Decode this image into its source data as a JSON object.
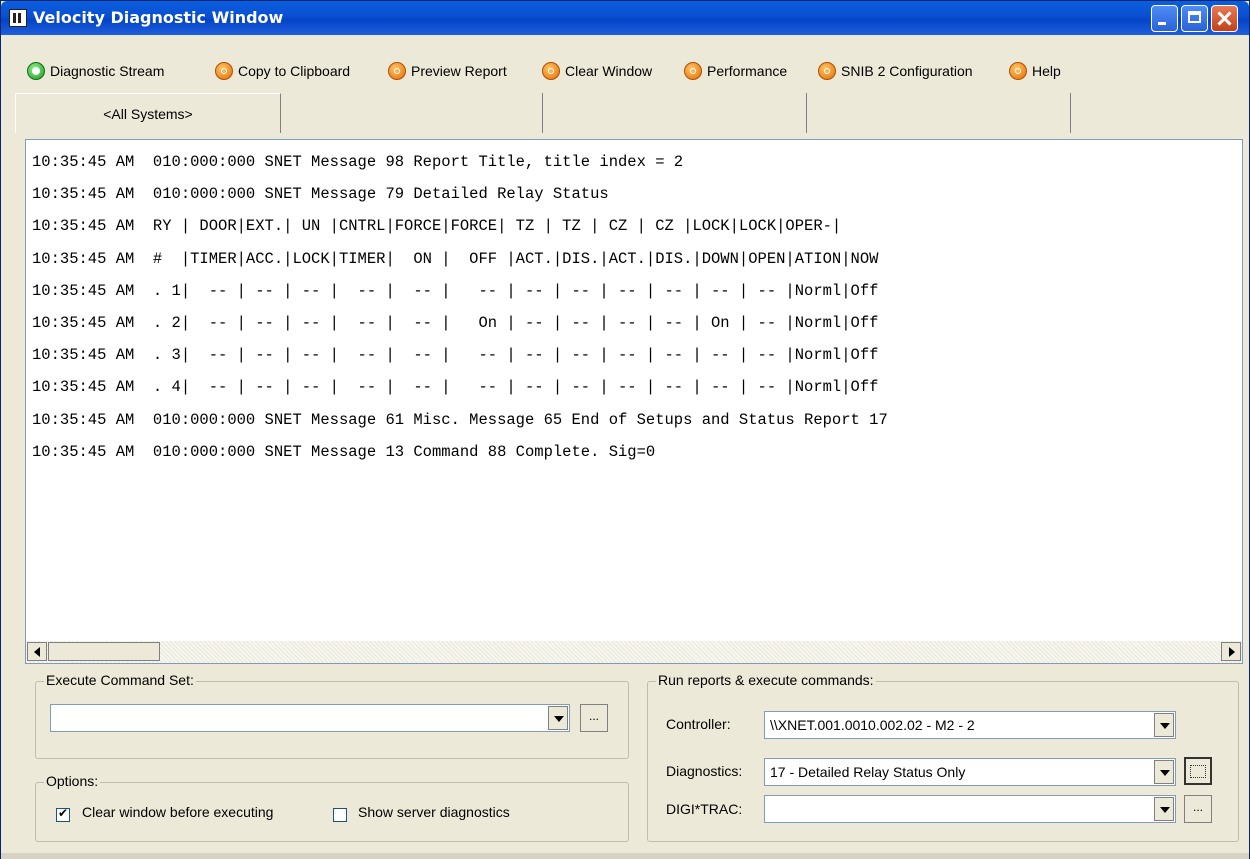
{
  "window": {
    "title": "Velocity Diagnostic Window"
  },
  "toolbar": {
    "items": [
      {
        "label": "Diagnostic Stream",
        "icon": "diagnostic-stream-icon"
      },
      {
        "label": "Copy to Clipboard",
        "icon": "copy-icon"
      },
      {
        "label": "Preview Report",
        "icon": "preview-icon"
      },
      {
        "label": "Clear Window",
        "icon": "clear-icon"
      },
      {
        "label": "Performance",
        "icon": "performance-icon"
      },
      {
        "label": "SNIB 2 Configuration",
        "icon": "snib-config-icon"
      },
      {
        "label": "Help",
        "icon": "help-icon"
      }
    ]
  },
  "tabs": [
    "<All Systems>",
    "",
    "",
    ""
  ],
  "log": {
    "lines": [
      "10:35:45 AM  010:000:000 SNET Message 98 Report Title, title index = 2",
      "10:35:45 AM  010:000:000 SNET Message 79 Detailed Relay Status",
      "10:35:45 AM  RY | DOOR|EXT.| UN |CNTRL|FORCE|FORCE| TZ | TZ | CZ | CZ |LOCK|LOCK|OPER-|",
      "10:35:45 AM  #  |TIMER|ACC.|LOCK|TIMER|  ON |  OFF |ACT.|DIS.|ACT.|DIS.|DOWN|OPEN|ATION|NOW",
      "10:35:45 AM  . 1|  -- | -- | -- |  -- |  -- |   -- | -- | -- | -- | -- | -- | -- |Norml|Off",
      "10:35:45 AM  . 2|  -- | -- | -- |  -- |  -- |   On | -- | -- | -- | -- | On | -- |Norml|Off",
      "10:35:45 AM  . 3|  -- | -- | -- |  -- |  -- |   -- | -- | -- | -- | -- | -- | -- |Norml|Off",
      "10:35:45 AM  . 4|  -- | -- | -- |  -- |  -- |   -- | -- | -- | -- | -- | -- | -- |Norml|Off",
      "10:35:45 AM  010:000:000 SNET Message 61 Misc. Message 65 End of Setups and Status Report 17",
      "10:35:45 AM  010:000:000 SNET Message 13 Command 88 Complete. Sig=0"
    ]
  },
  "execute": {
    "label": "Execute Command Set:",
    "value": "",
    "ellipsis": "..."
  },
  "options": {
    "label": "Options:",
    "clear_window": {
      "label": "Clear window before executing",
      "checked": true
    },
    "show_server": {
      "label": "Show server diagnostics",
      "checked": false
    }
  },
  "run": {
    "label": "Run reports & execute commands:",
    "controller_label": "Controller:",
    "controller_value": "\\\\XNET.001.0010.002.02 - M2 - 2",
    "diagnostics_label": "Diagnostics:",
    "diagnostics_value": "17 - Detailed Relay Status Only",
    "digitrac_label": "DIGI*TRAC:",
    "digitrac_value": "",
    "ellipsis": "..."
  }
}
